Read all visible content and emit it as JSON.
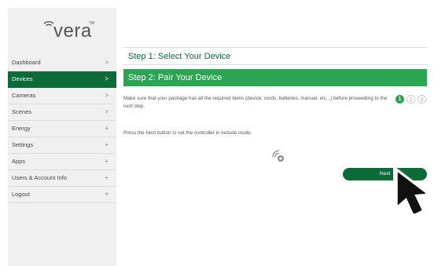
{
  "logo": {
    "text": "vera",
    "trademark": "TM",
    "icon": "vera-wifi-logo-icon"
  },
  "sidebar": {
    "items": [
      {
        "label": "Dashboard",
        "glyph": ">",
        "active": false
      },
      {
        "label": "Devices",
        "glyph": ">",
        "active": true
      },
      {
        "label": "Cameras",
        "glyph": ">",
        "active": false
      },
      {
        "label": "Scenes",
        "glyph": ">",
        "active": false
      },
      {
        "label": "Energy",
        "glyph": "+",
        "active": false
      },
      {
        "label": "Settings",
        "glyph": "+",
        "active": false
      },
      {
        "label": "Apps",
        "glyph": "+",
        "active": false
      },
      {
        "label": "Users & Account Info",
        "glyph": "+",
        "active": false
      },
      {
        "label": "Logout",
        "glyph": "×",
        "active": false
      }
    ]
  },
  "main": {
    "step1_title": "Step 1: Select Your Device",
    "step2_title": "Step 2: Pair Your Device",
    "description": "Make sure that your package has all the required items (device, cords, batteries, manual, etc...) before proceeding to the next step.",
    "progress": {
      "steps": [
        "1",
        "2",
        "3"
      ],
      "current": 1
    },
    "instruction": "Press the Next button to set the controller in include mode.",
    "status_icon": "wifi-plus-icon",
    "next_label": "Next"
  },
  "colors": {
    "brand_dark": "#0d6b3a",
    "brand_light": "#2aa552",
    "sidebar_bg": "#f0f0f0"
  },
  "pointer": {
    "icon": "mouse-pointer-icon"
  }
}
